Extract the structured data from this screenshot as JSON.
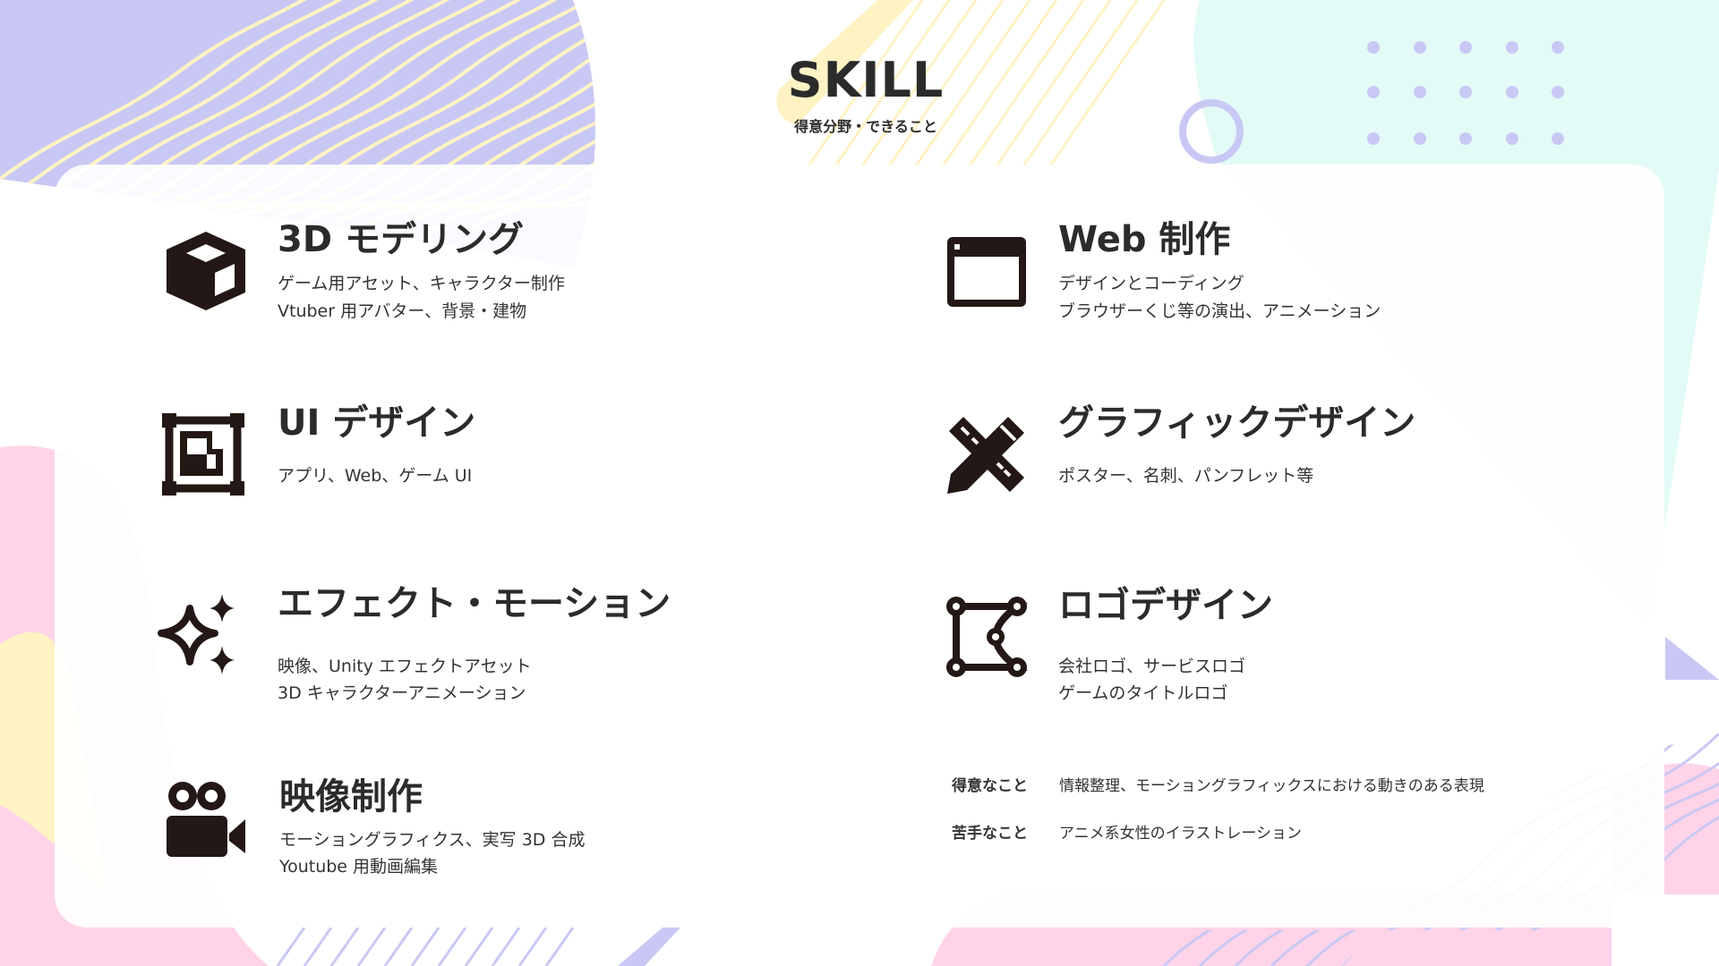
{
  "header": {
    "title": "SKILL",
    "subtitle": "得意分野・できること"
  },
  "colors": {
    "purple": "#c9c8f5",
    "mint": "#e3fbf6",
    "pink": "#ffd3e8",
    "yellow": "#fff3c4",
    "ink": "#231815"
  },
  "skills": [
    {
      "icon": "cube-icon",
      "title": "3D モデリング",
      "lines": [
        "ゲーム用アセット、キャラクター制作",
        "Vtuber 用アバター、背景・建物"
      ]
    },
    {
      "icon": "browser-window-icon",
      "title": "Web 制作",
      "lines": [
        "デザインとコーディング",
        "ブラウザーくじ等の演出、アニメーション"
      ]
    },
    {
      "icon": "ui-layout-icon",
      "title": "UI デザイン",
      "lines": [
        "アプリ、Web、ゲーム UI"
      ]
    },
    {
      "icon": "pencil-ruler-icon",
      "title": "グラフィックデザイン",
      "lines": [
        "ポスター、名刺、パンフレット等"
      ]
    },
    {
      "icon": "sparkles-icon",
      "title": "エフェクト・モーション",
      "lines": [
        "映像、Unity エフェクトアセット",
        "3D キャラクターアニメーション"
      ]
    },
    {
      "icon": "vector-path-icon",
      "title": "ロゴデザイン",
      "lines": [
        "会社ロゴ、サービスロゴ",
        "ゲームのタイトルロゴ"
      ]
    },
    {
      "icon": "video-camera-icon",
      "title": "映像制作",
      "lines": [
        "モーショングラフィクス、実写 3D 合成",
        "Youtube 用動画編集"
      ]
    }
  ],
  "notes": [
    {
      "label": "得意なこと",
      "value": "情報整理、モーショングラフィックスにおける動きのある表現"
    },
    {
      "label": "苦手なこと",
      "value": "アニメ系女性のイラストレーション"
    }
  ]
}
